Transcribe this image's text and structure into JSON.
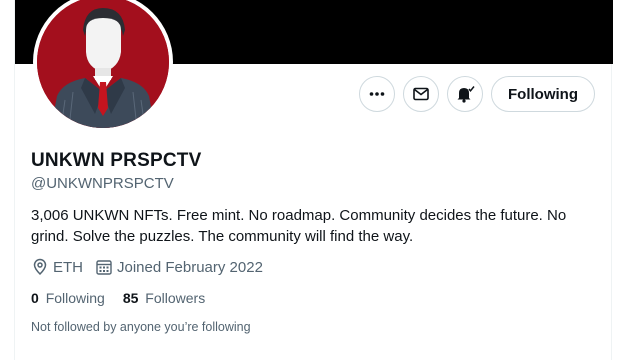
{
  "profile": {
    "display_name": "UNKWN PRSPCTV",
    "handle": "@UNKWNPRSPCTV",
    "bio": "3,006 UNKWN NFTs. Free mint. No roadmap. Community decides the future. No grind. Solve the puzzles. The community will find the way.",
    "location": "ETH",
    "joined": "Joined February 2022",
    "following_count": "0",
    "following_label": "Following",
    "followers_count": "85",
    "followers_label": "Followers",
    "followed_by_note": "Not followed by anyone you’re following"
  },
  "actions": {
    "more_icon": "more-horizontal-icon",
    "message_icon": "envelope-icon",
    "notify_icon": "bell-check-icon",
    "follow_label": "Following"
  },
  "colors": {
    "banner": "#000000",
    "avatar_background": "#a30f1d",
    "text_primary": "#0f1419",
    "text_secondary": "#536471",
    "border": "#cfd9de"
  }
}
